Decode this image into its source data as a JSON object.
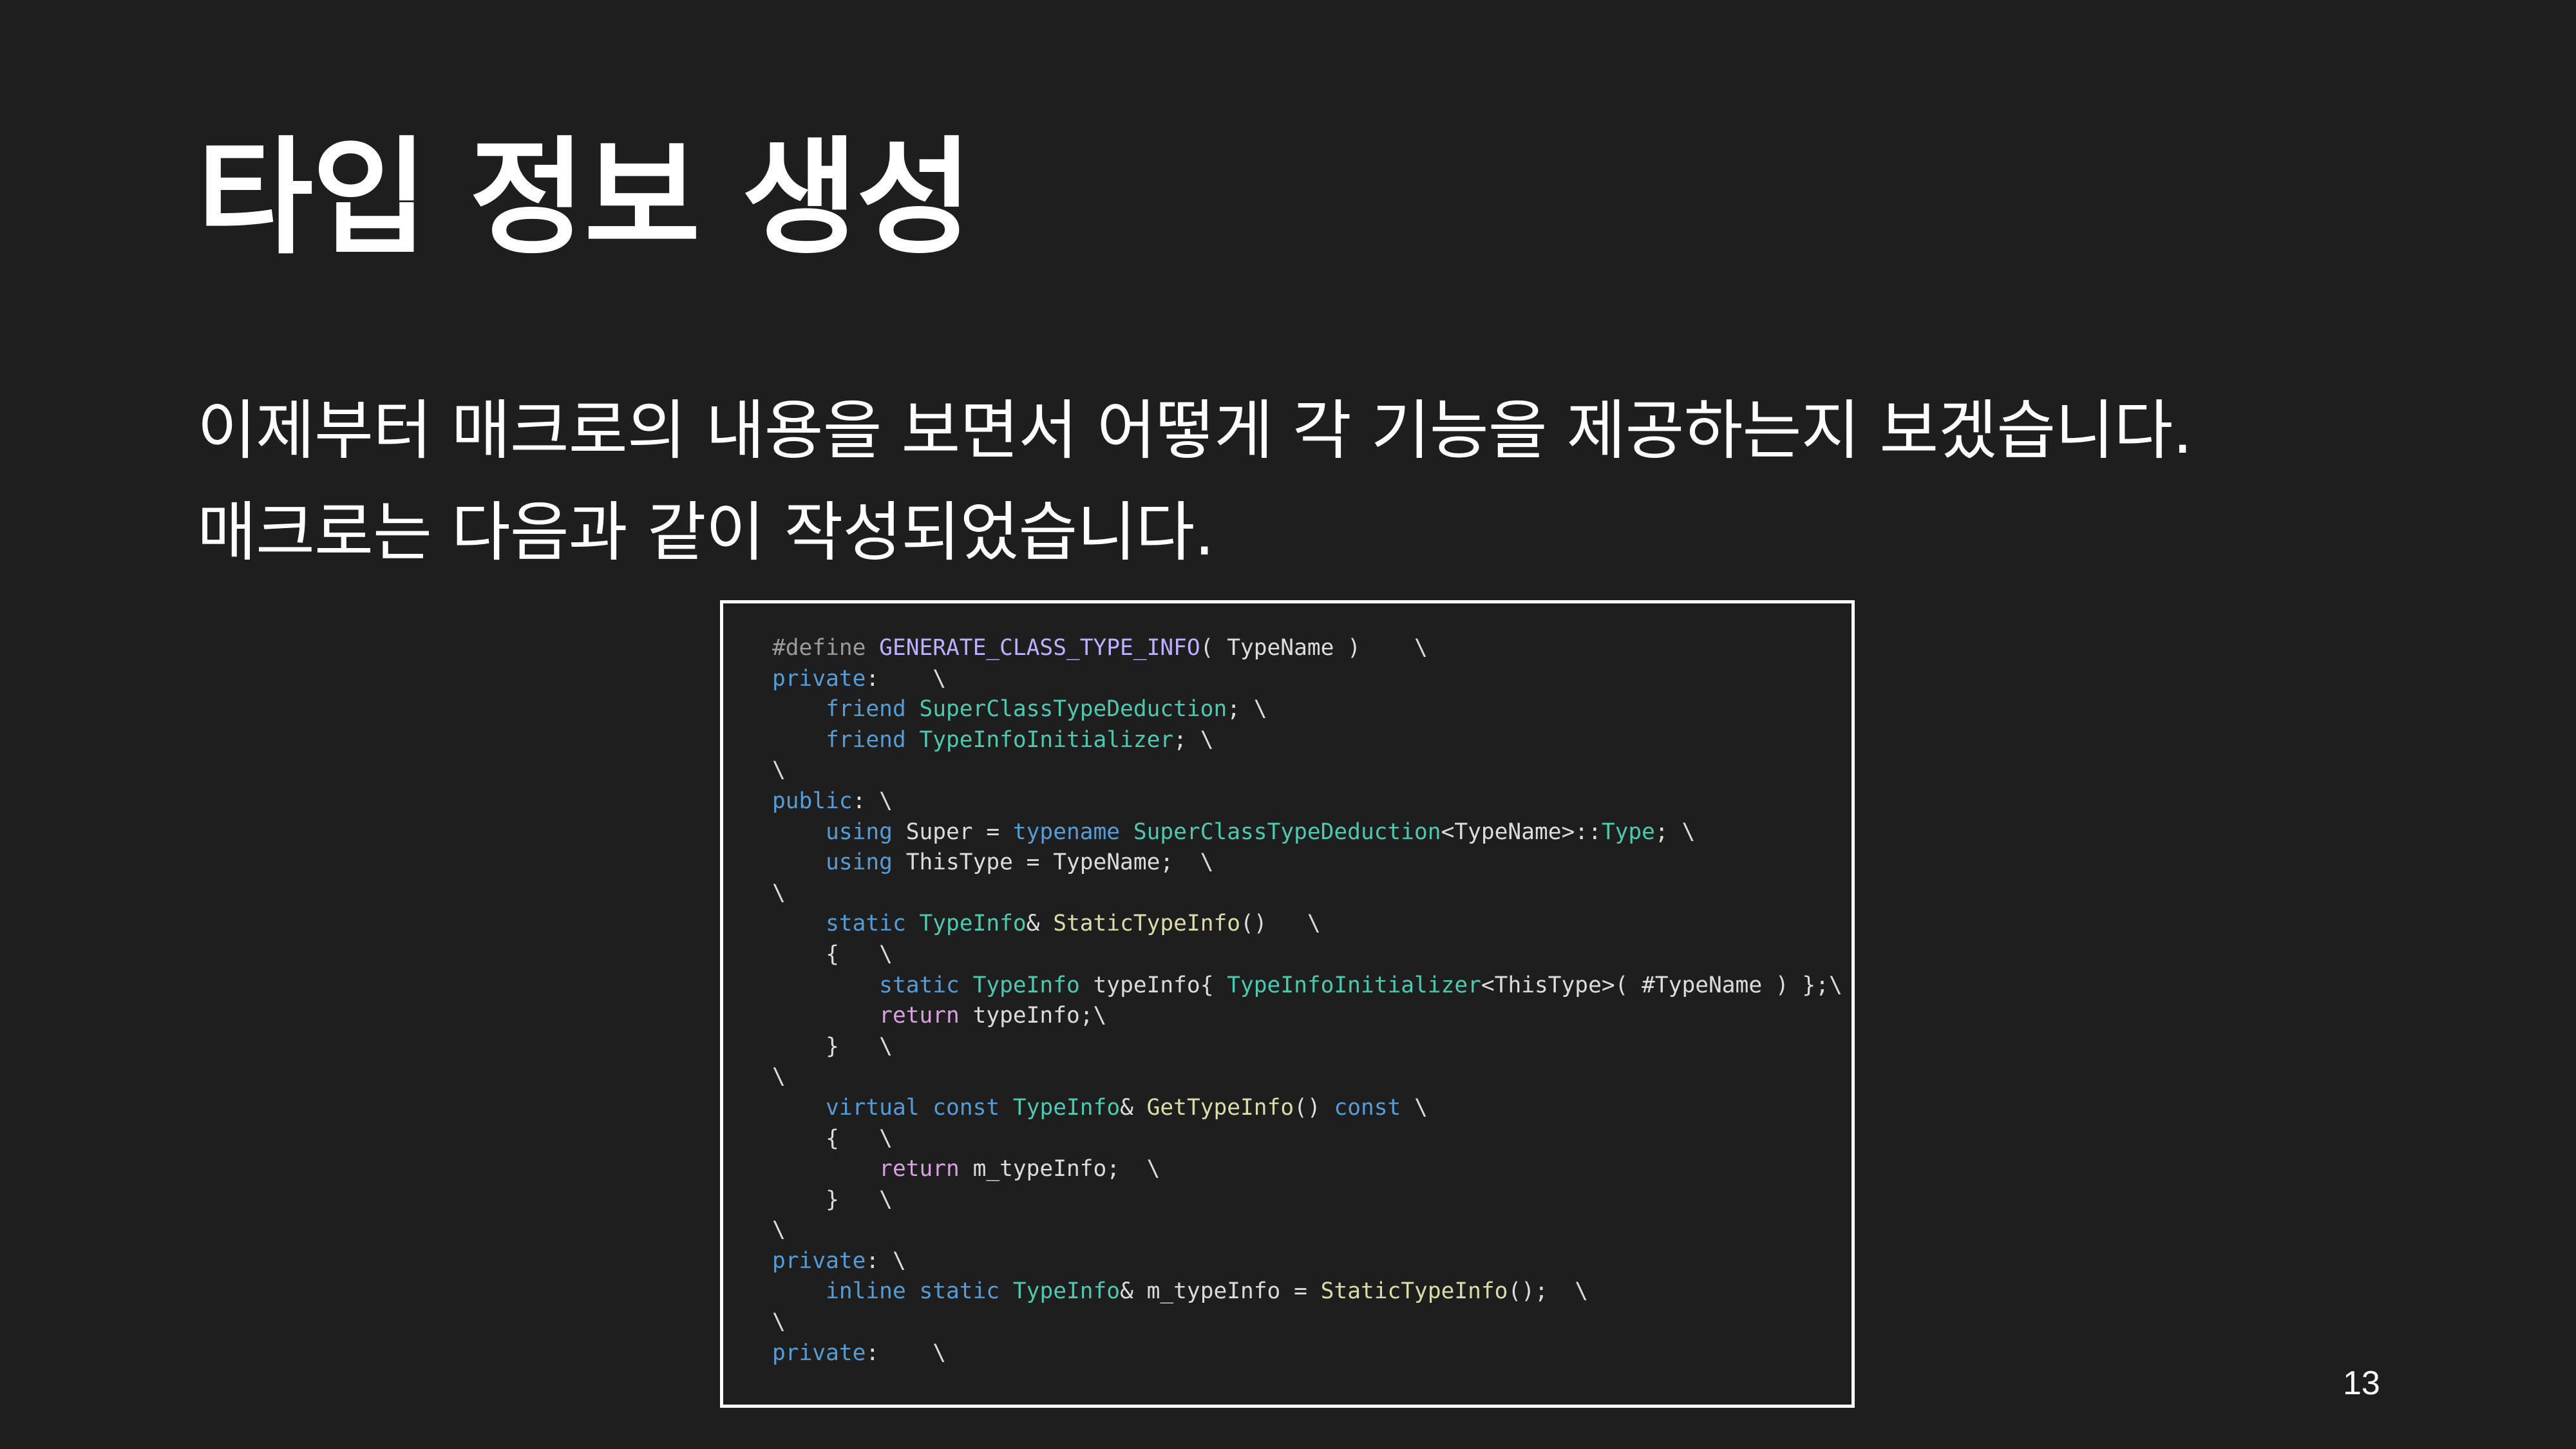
{
  "slide": {
    "title": "타입 정보 생성",
    "body_lines": [
      "이제부터 매크로의 내용을 보면서 어떻게 각 기능을 제공하는지 보겠습니다.",
      "매크로는 다음과 같이 작성되었습니다."
    ],
    "page_number": "13"
  },
  "code": {
    "lines": [
      [
        {
          "t": "#define ",
          "c": "pp"
        },
        {
          "t": "GENERATE_CLASS_TYPE_INFO",
          "c": "mc"
        },
        {
          "t": "( TypeName )    \\",
          "c": "id"
        }
      ],
      [
        {
          "t": "private",
          "c": "kw"
        },
        {
          "t": ":    \\",
          "c": "id"
        }
      ],
      [
        {
          "t": "    ",
          "c": "id"
        },
        {
          "t": "friend",
          "c": "kw"
        },
        {
          "t": " ",
          "c": "id"
        },
        {
          "t": "SuperClassTypeDeduction",
          "c": "ty"
        },
        {
          "t": "; \\",
          "c": "id"
        }
      ],
      [
        {
          "t": "    ",
          "c": "id"
        },
        {
          "t": "friend",
          "c": "kw"
        },
        {
          "t": " ",
          "c": "id"
        },
        {
          "t": "TypeInfoInitializer",
          "c": "ty"
        },
        {
          "t": "; \\",
          "c": "id"
        }
      ],
      [
        {
          "t": "\\",
          "c": "id"
        }
      ],
      [
        {
          "t": "public",
          "c": "kw"
        },
        {
          "t": ": \\",
          "c": "id"
        }
      ],
      [
        {
          "t": "    ",
          "c": "id"
        },
        {
          "t": "using",
          "c": "kw"
        },
        {
          "t": " Super = ",
          "c": "id"
        },
        {
          "t": "typename",
          "c": "kw"
        },
        {
          "t": " ",
          "c": "id"
        },
        {
          "t": "SuperClassTypeDeduction",
          "c": "ty"
        },
        {
          "t": "<TypeName>::",
          "c": "id"
        },
        {
          "t": "Type",
          "c": "ty"
        },
        {
          "t": "; \\",
          "c": "id"
        }
      ],
      [
        {
          "t": "    ",
          "c": "id"
        },
        {
          "t": "using",
          "c": "kw"
        },
        {
          "t": " ThisType = TypeName;  \\",
          "c": "id"
        }
      ],
      [
        {
          "t": "\\",
          "c": "id"
        }
      ],
      [
        {
          "t": "    ",
          "c": "id"
        },
        {
          "t": "static",
          "c": "kw"
        },
        {
          "t": " ",
          "c": "id"
        },
        {
          "t": "TypeInfo",
          "c": "ty"
        },
        {
          "t": "& ",
          "c": "id"
        },
        {
          "t": "StaticTypeInfo",
          "c": "fn"
        },
        {
          "t": "()   \\",
          "c": "id"
        }
      ],
      [
        {
          "t": "    {   \\",
          "c": "id"
        }
      ],
      [
        {
          "t": "        ",
          "c": "id"
        },
        {
          "t": "static",
          "c": "kw"
        },
        {
          "t": " ",
          "c": "id"
        },
        {
          "t": "TypeInfo",
          "c": "ty"
        },
        {
          "t": " ",
          "c": "id"
        },
        {
          "t": "typeInfo",
          "c": "mb"
        },
        {
          "t": "{ ",
          "c": "id"
        },
        {
          "t": "TypeInfoInitializer",
          "c": "ty"
        },
        {
          "t": "<ThisType>( #TypeName ) };\\",
          "c": "id"
        }
      ],
      [
        {
          "t": "        ",
          "c": "id"
        },
        {
          "t": "return",
          "c": "pk"
        },
        {
          "t": " typeInfo;\\",
          "c": "id"
        }
      ],
      [
        {
          "t": "    }   \\",
          "c": "id"
        }
      ],
      [
        {
          "t": "\\",
          "c": "id"
        }
      ],
      [
        {
          "t": "    ",
          "c": "id"
        },
        {
          "t": "virtual",
          "c": "kw"
        },
        {
          "t": " ",
          "c": "id"
        },
        {
          "t": "const",
          "c": "kw"
        },
        {
          "t": " ",
          "c": "id"
        },
        {
          "t": "TypeInfo",
          "c": "ty"
        },
        {
          "t": "& ",
          "c": "id"
        },
        {
          "t": "GetTypeInfo",
          "c": "fn"
        },
        {
          "t": "() ",
          "c": "id"
        },
        {
          "t": "const",
          "c": "kw"
        },
        {
          "t": " \\",
          "c": "id"
        }
      ],
      [
        {
          "t": "    {   \\",
          "c": "id"
        }
      ],
      [
        {
          "t": "        ",
          "c": "id"
        },
        {
          "t": "return",
          "c": "pk"
        },
        {
          "t": " m_typeInfo;  \\",
          "c": "id"
        }
      ],
      [
        {
          "t": "    }   \\",
          "c": "id"
        }
      ],
      [
        {
          "t": "\\",
          "c": "id"
        }
      ],
      [
        {
          "t": "private",
          "c": "kw"
        },
        {
          "t": ": \\",
          "c": "id"
        }
      ],
      [
        {
          "t": "    ",
          "c": "id"
        },
        {
          "t": "inline",
          "c": "kw"
        },
        {
          "t": " ",
          "c": "id"
        },
        {
          "t": "static",
          "c": "kw"
        },
        {
          "t": " ",
          "c": "id"
        },
        {
          "t": "TypeInfo",
          "c": "ty"
        },
        {
          "t": "& ",
          "c": "id"
        },
        {
          "t": "m_typeInfo",
          "c": "mb"
        },
        {
          "t": " = ",
          "c": "id"
        },
        {
          "t": "StaticTypeInfo",
          "c": "fn"
        },
        {
          "t": "();  \\",
          "c": "id"
        }
      ],
      [
        {
          "t": "\\",
          "c": "id"
        }
      ],
      [
        {
          "t": "private",
          "c": "kw"
        },
        {
          "t": ":    \\",
          "c": "id"
        }
      ]
    ],
    "colors": {
      "background": "#1e1e1e",
      "keyword": "#569cd6",
      "type": "#4ec9b0",
      "macro": "#bdb0ff",
      "control": "#d8a0df",
      "preprocessor": "#9b9b9b",
      "text": "#dcdcdc"
    }
  }
}
